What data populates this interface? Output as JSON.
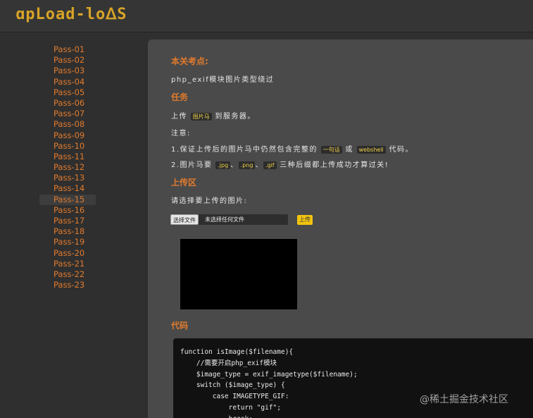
{
  "header": {
    "logo": "ɑpLoad-loᐃS"
  },
  "sidebar": {
    "items": [
      "Pass-01",
      "Pass-02",
      "Pass-03",
      "Pass-04",
      "Pass-05",
      "Pass-06",
      "Pass-07",
      "Pass-08",
      "Pass-09",
      "Pass-10",
      "Pass-11",
      "Pass-12",
      "Pass-13",
      "Pass-14",
      "Pass-15",
      "Pass-16",
      "Pass-17",
      "Pass-18",
      "Pass-19",
      "Pass-20",
      "Pass-21",
      "Pass-22",
      "Pass-23"
    ],
    "active": "Pass-15"
  },
  "content": {
    "topic_title": "本关考点:",
    "topic_text": "php_exif模块图片类型绕过",
    "task_title": "任务",
    "task_prefix": "上传",
    "task_badge": "图片马",
    "task_suffix": "到服务器。",
    "note_label": "注意:",
    "note1_prefix": "1.保证上传后的图片马中仍然包含完整的",
    "note1_badge1": "一句话",
    "note1_mid": "或",
    "note1_badge2": "webshell",
    "note1_suffix": "代码。",
    "note2_prefix": "2.图片马要",
    "note2_ext1": ".jpg",
    "note2_sep1": "、",
    "note2_ext2": ".png",
    "note2_sep2": "、",
    "note2_ext3": ".gif",
    "note2_suffix": "三种后缀都上传成功才算过关!",
    "upload_title": "上传区",
    "upload_prompt": "请选择要上传的图片:",
    "file_button": "选择文件",
    "file_status": "未选择任何文件",
    "upload_button": "上传",
    "code_title": "代码",
    "code": "function isImage($filename){\n    //需要开启php_exif模块\n    $image_type = exif_imagetype($filename);\n    switch ($image_type) {\n        case IMAGETYPE_GIF:\n            return \"gif\";\n            break;"
  },
  "watermark": "@稀土掘金技术社区",
  "colors": {
    "accent": "#e07a2c",
    "logo": "#d8a428",
    "button": "#f1c40f"
  }
}
